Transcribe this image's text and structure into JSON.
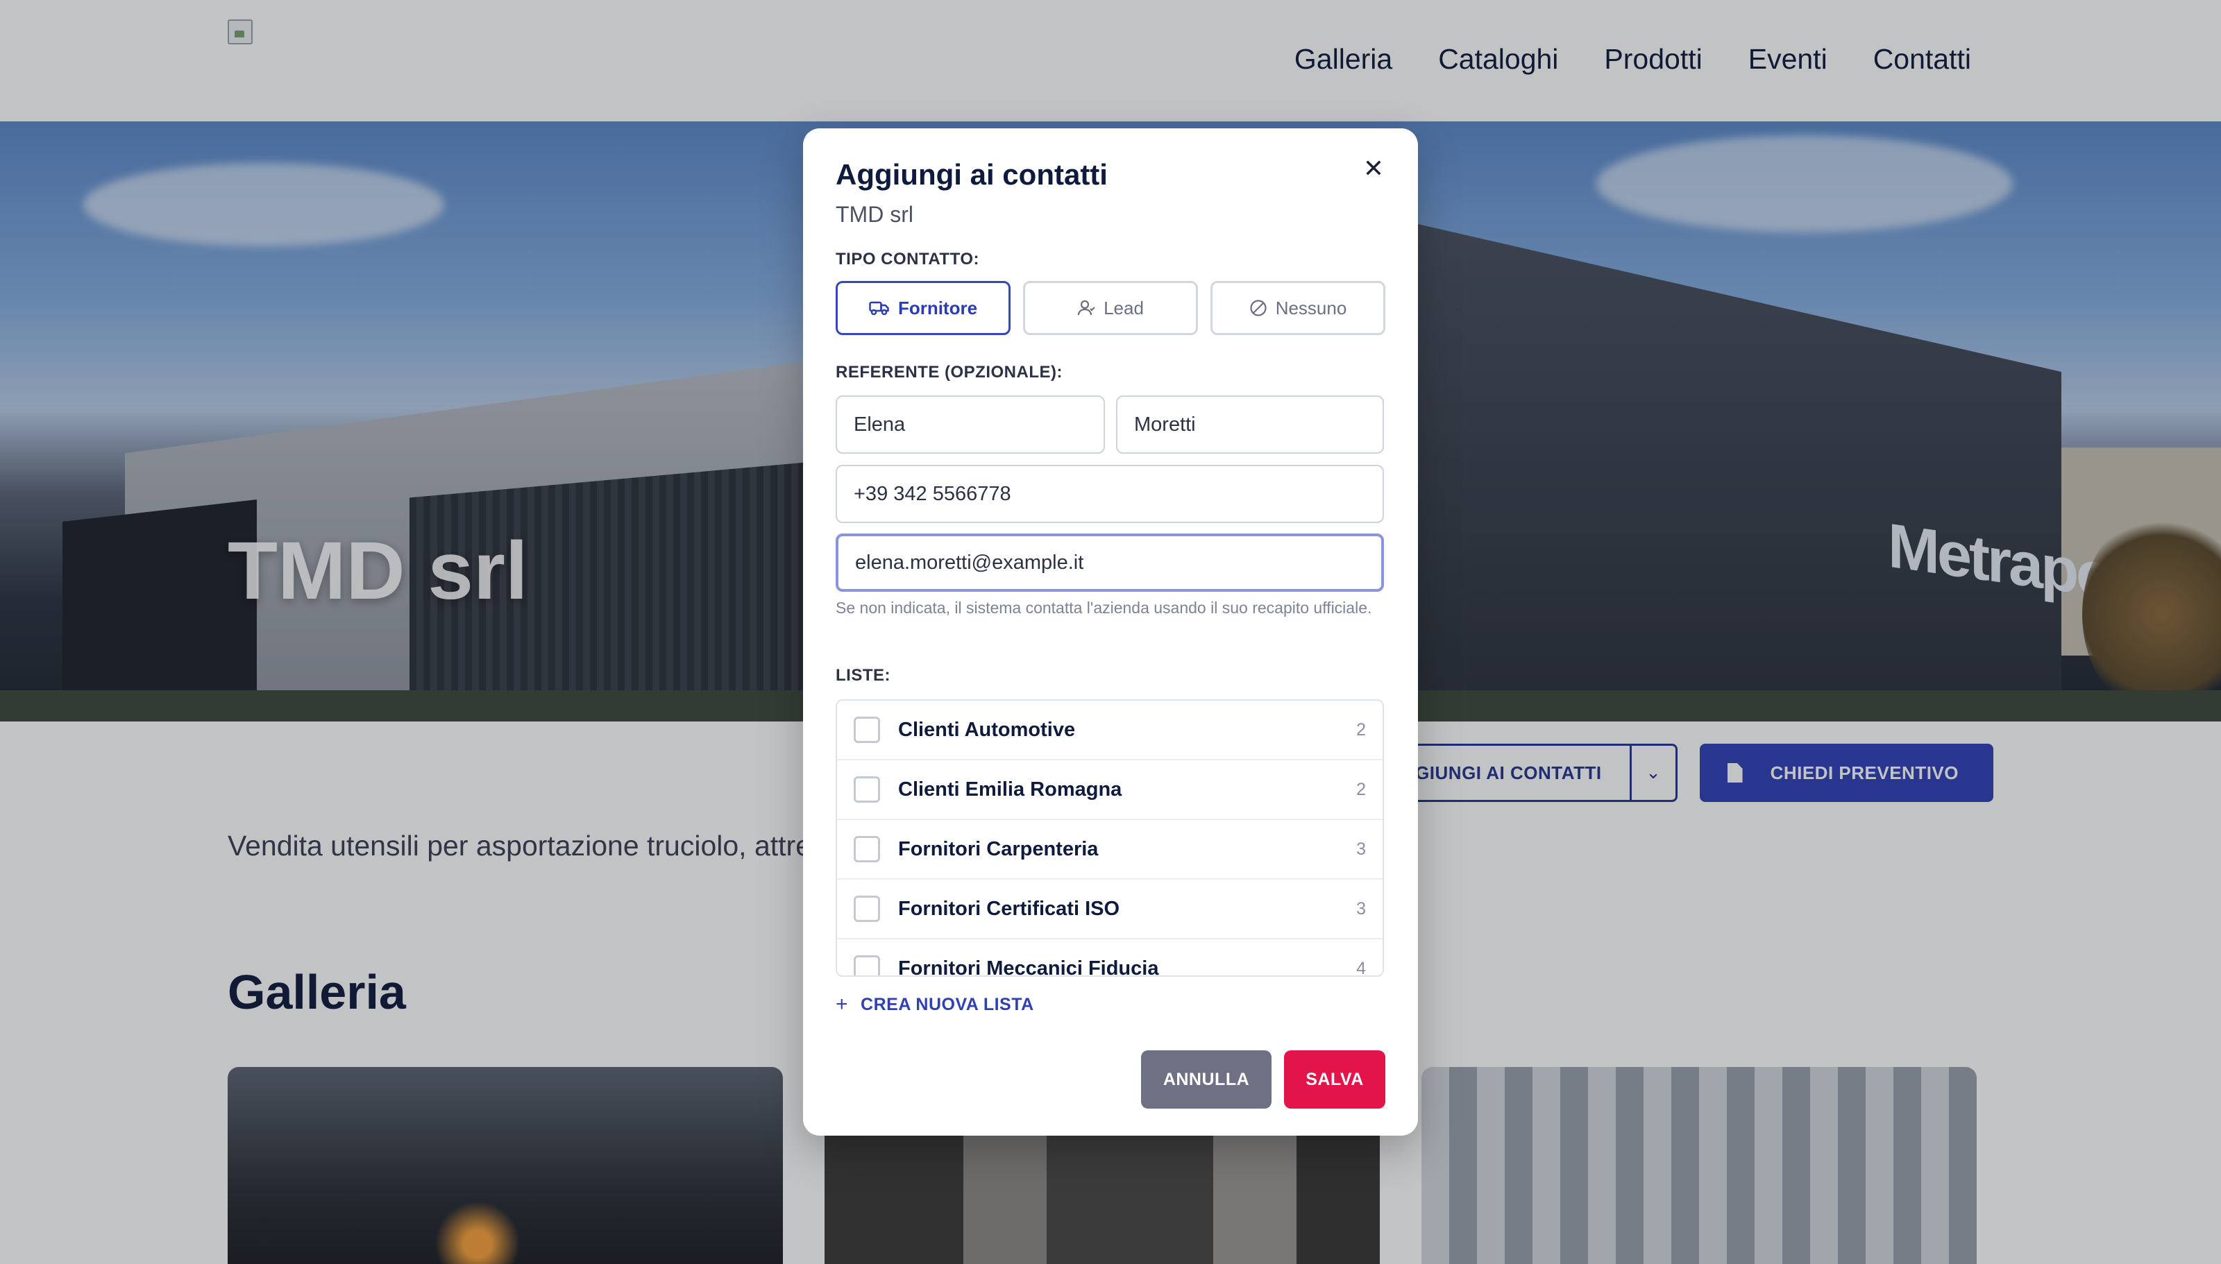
{
  "nav": {
    "items": [
      "Galleria",
      "Cataloghi",
      "Prodotti",
      "Eventi",
      "Contatti"
    ]
  },
  "hero": {
    "company_name": "TMD srl",
    "building_sign": "Metrapoint"
  },
  "actions": {
    "add_contacts_label": "AGGIUNGI AI CONTATTI",
    "quote_label": "CHIEDI PREVENTIVO"
  },
  "description": "Vendita utensili per asportazione truciolo, attrezzature e strumenti di misura",
  "gallery": {
    "title": "Galleria"
  },
  "modal": {
    "title": "Aggiungi ai contatti",
    "subtitle": "TMD srl",
    "contact_type_label": "TIPO CONTATTO:",
    "contact_types": [
      {
        "label": "Fornitore",
        "icon": "truck-icon",
        "selected": true
      },
      {
        "label": "Lead",
        "icon": "user-icon",
        "selected": false
      },
      {
        "label": "Nessuno",
        "icon": "ban-icon",
        "selected": false
      }
    ],
    "referent_label": "REFERENTE (OPZIONALE):",
    "first_name": "Elena",
    "last_name": "Moretti",
    "phone": "+39 342 5566778",
    "email": "elena.moretti@example.it",
    "hint": "Se non indicata, il sistema contatta l'azienda usando il suo recapito ufficiale.",
    "lists_label": "LISTE:",
    "lists": [
      {
        "name": "Clienti Automotive",
        "count": "2"
      },
      {
        "name": "Clienti Emilia Romagna",
        "count": "2"
      },
      {
        "name": "Fornitori Carpenteria",
        "count": "3"
      },
      {
        "name": "Fornitori Certificati ISO",
        "count": "3"
      },
      {
        "name": "Fornitori Meccanici Fiducia",
        "count": "4"
      }
    ],
    "new_list_label": "CREA NUOVA LISTA",
    "cancel_label": "ANNULLA",
    "save_label": "SALVA"
  },
  "colors": {
    "primary": "#3042b6",
    "save": "#e2144a",
    "cancel": "#6d7183",
    "navy_text": "#0f1b3d"
  }
}
